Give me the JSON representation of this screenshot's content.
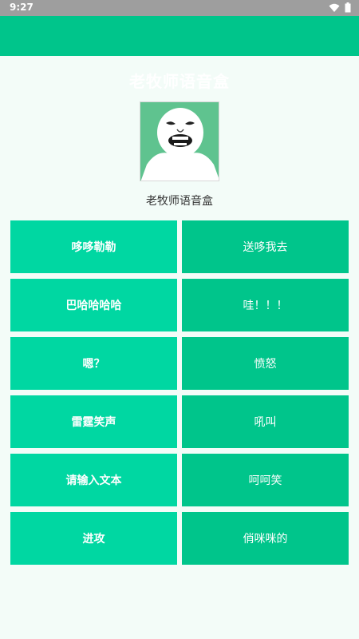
{
  "status": {
    "time": "9:27"
  },
  "header": {
    "title": "老牧师语音盒"
  },
  "app": {
    "name": "老牧师语音盒"
  },
  "buttons": [
    {
      "label": "哆哆勒勒"
    },
    {
      "label": "送哆我去"
    },
    {
      "label": "巴哈哈哈哈"
    },
    {
      "label": "哇！！！"
    },
    {
      "label": "嗯？"
    },
    {
      "label": "愤怒"
    },
    {
      "label": "雷霆笑声"
    },
    {
      "label": "吼叫"
    },
    {
      "label": "请输入文本"
    },
    {
      "label": "呵呵笑"
    },
    {
      "label": "进攻"
    },
    {
      "label": "俏咪咪的"
    }
  ],
  "colors": {
    "primary": "#00C58B",
    "left_button": "#00D7A2",
    "background": "#F3FCF8"
  }
}
